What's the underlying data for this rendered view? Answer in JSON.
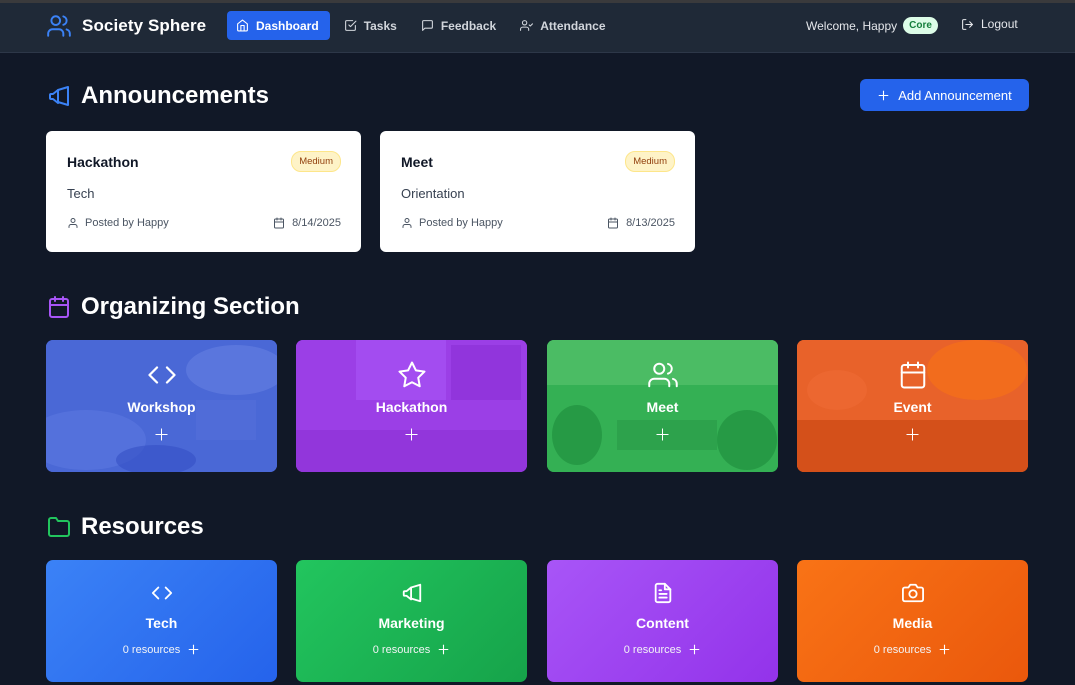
{
  "app": {
    "name": "Society Sphere"
  },
  "nav": {
    "items": [
      {
        "label": "Dashboard",
        "icon": "home-icon",
        "active": true
      },
      {
        "label": "Tasks",
        "icon": "check-square-icon",
        "active": false
      },
      {
        "label": "Feedback",
        "icon": "message-square-icon",
        "active": false
      },
      {
        "label": "Attendance",
        "icon": "user-check-icon",
        "active": false
      }
    ],
    "welcome": "Welcome, Happy",
    "role_badge": "Core",
    "logout": "Logout"
  },
  "announcements": {
    "title": "Announcements",
    "add_button": "Add Announcement",
    "items": [
      {
        "title": "Hackathon",
        "priority": "Medium",
        "category": "Tech",
        "posted_by": "Posted by Happy",
        "date": "8/14/2025"
      },
      {
        "title": "Meet",
        "priority": "Medium",
        "category": "Orientation",
        "posted_by": "Posted by Happy",
        "date": "8/13/2025"
      }
    ]
  },
  "organizing": {
    "title": "Organizing Section",
    "items": [
      {
        "label": "Workshop",
        "icon": "code-icon",
        "color": "#3b5bdb"
      },
      {
        "label": "Hackathon",
        "icon": "star-icon",
        "color": "#9333ea"
      },
      {
        "label": "Meet",
        "icon": "users-icon",
        "color": "#22a447"
      },
      {
        "label": "Event",
        "icon": "calendar-icon",
        "color": "#ea580c"
      }
    ]
  },
  "resources": {
    "title": "Resources",
    "items": [
      {
        "label": "Tech",
        "count": "0 resources",
        "icon": "code-icon",
        "color": "#2563eb"
      },
      {
        "label": "Marketing",
        "count": "0 resources",
        "icon": "megaphone-icon",
        "color": "#16a34a"
      },
      {
        "label": "Content",
        "count": "0 resources",
        "icon": "file-text-icon",
        "color": "#9333ea"
      },
      {
        "label": "Media",
        "count": "0 resources",
        "icon": "camera-icon",
        "color": "#ea580c"
      }
    ]
  },
  "colors": {
    "background": "#111827",
    "navbar": "#1f2937",
    "primary": "#2563eb",
    "badge_bg": "#fef3c7",
    "badge_text": "#92400e"
  }
}
